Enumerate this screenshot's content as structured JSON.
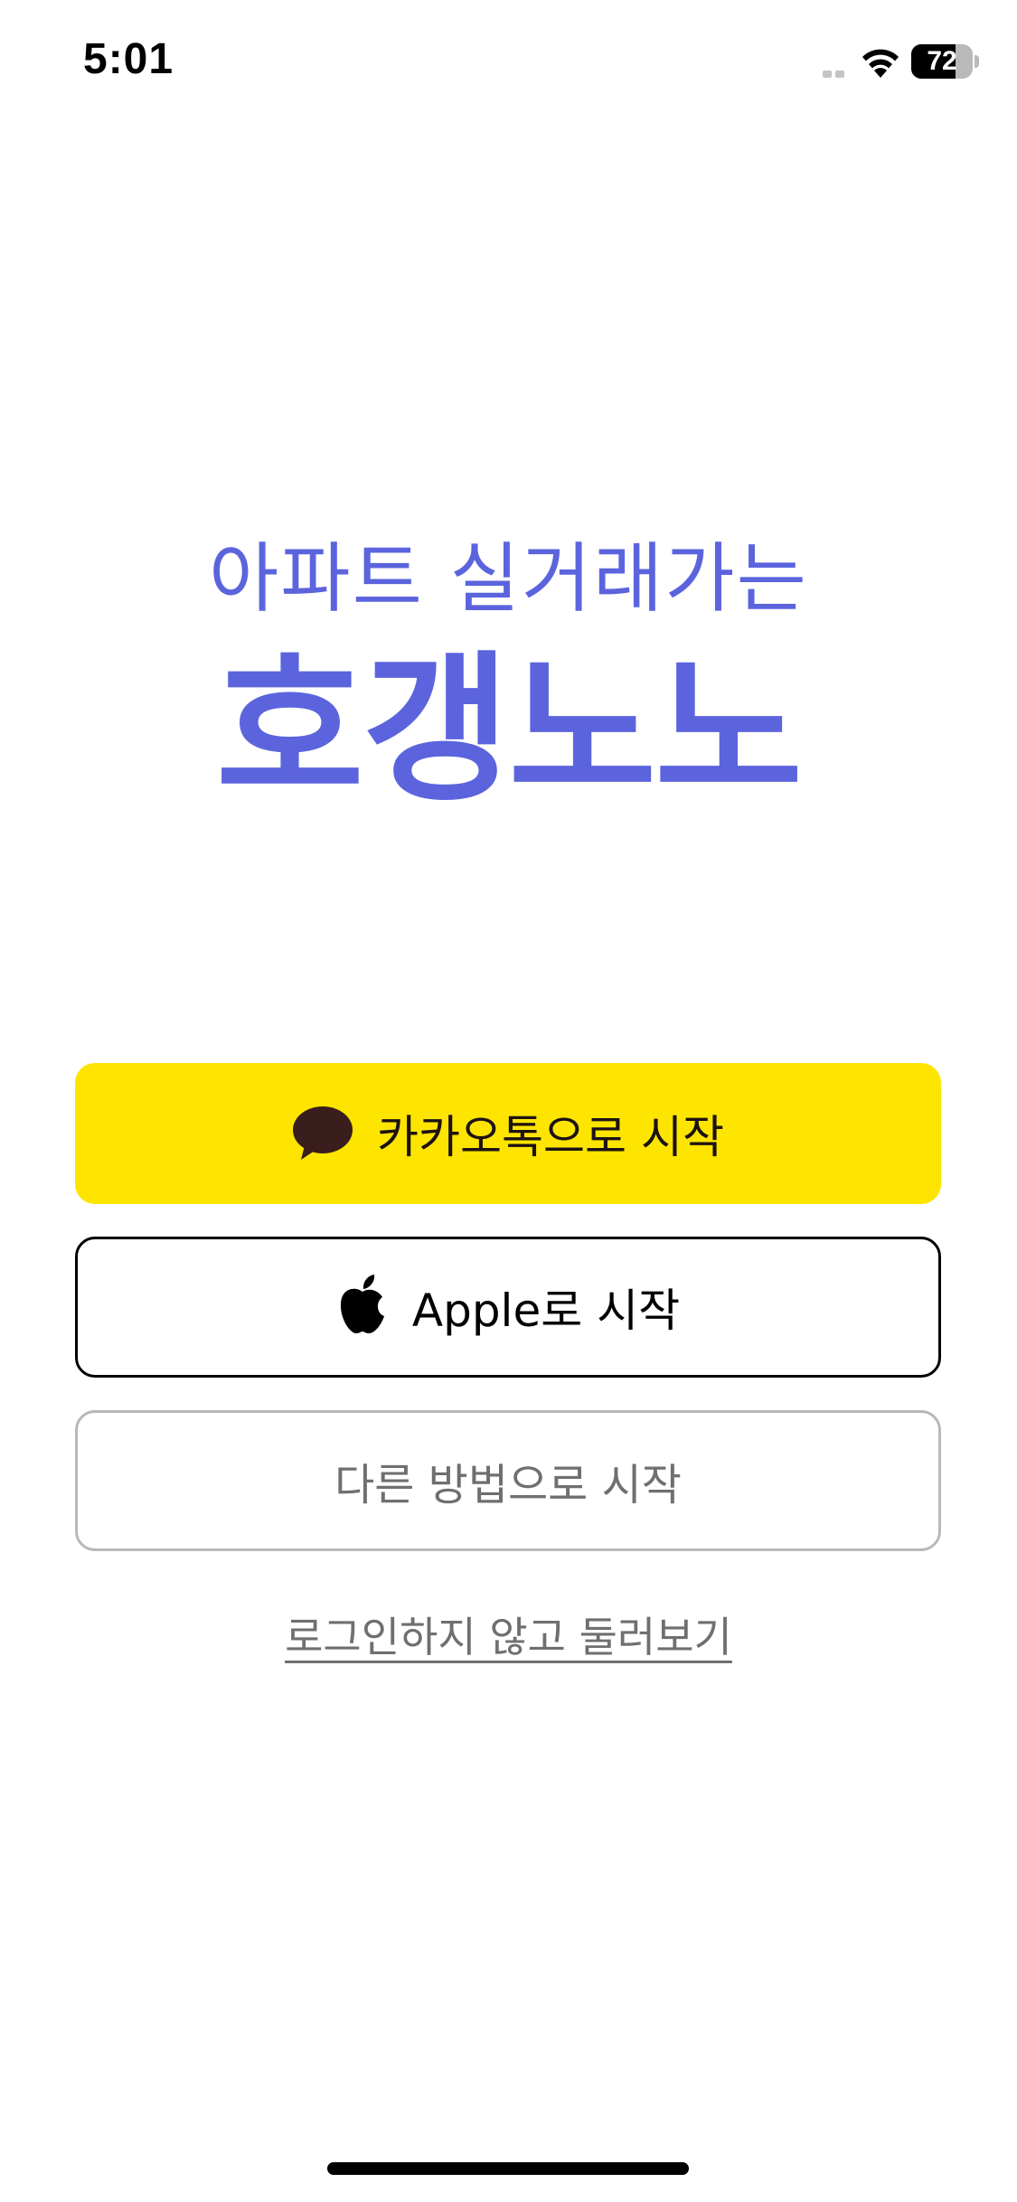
{
  "status_bar": {
    "time": "5:01",
    "battery_level": "72",
    "icons": [
      "signal-icon",
      "wifi-icon",
      "battery-icon"
    ]
  },
  "logo": {
    "tagline": "아파트 실거래가는",
    "brand": "호갱노노",
    "color": "#5b64dd"
  },
  "buttons": {
    "kakao_label": "카카오톡으로 시작",
    "apple_label": "Apple로 시작",
    "other_label": "다른 방법으로 시작"
  },
  "browse_link": "로그인하지 않고 둘러보기",
  "colors": {
    "kakao_yellow": "#fee500",
    "kakao_brown": "#3a1d1d",
    "apple_border": "#000000",
    "other_border": "#b8b8b8"
  }
}
